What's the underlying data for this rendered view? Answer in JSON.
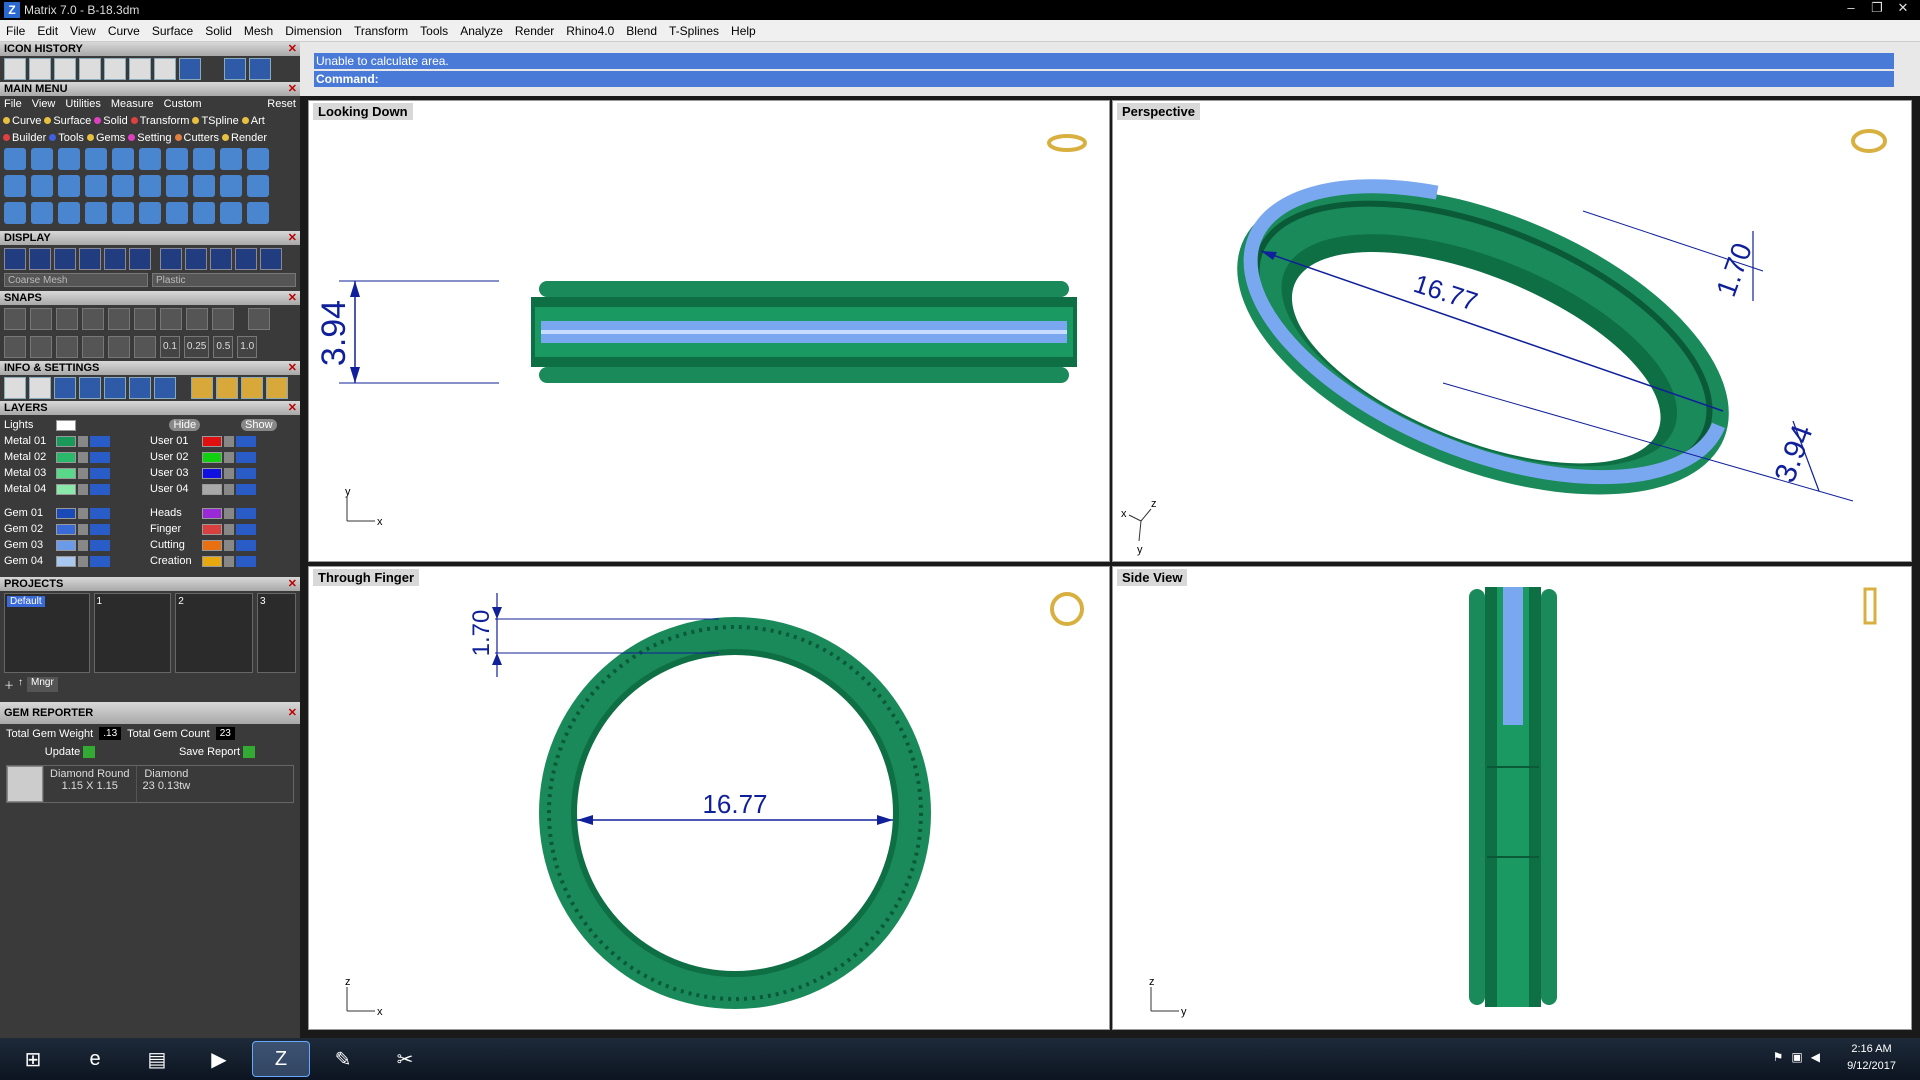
{
  "window": {
    "title": "Matrix 7.0 - B-18.3dm",
    "controls": [
      "–",
      "❐",
      "✕"
    ]
  },
  "menubar": [
    "File",
    "Edit",
    "View",
    "Curve",
    "Surface",
    "Solid",
    "Mesh",
    "Dimension",
    "Transform",
    "Tools",
    "Analyze",
    "Render",
    "Rhino4.0",
    "Blend",
    "T-Splines",
    "Help"
  ],
  "left": {
    "icon_history": "ICON HISTORY",
    "main_menu": {
      "title": "MAIN MENU",
      "tabs": [
        "File",
        "View",
        "Utilities",
        "Measure",
        "Custom"
      ],
      "reset": "Reset",
      "row1": [
        {
          "label": "Curve",
          "color": "#e8c040"
        },
        {
          "label": "Surface",
          "color": "#e8c040"
        },
        {
          "label": "Solid",
          "color": "#e040c0"
        },
        {
          "label": "Transform",
          "color": "#e04040"
        },
        {
          "label": "TSpline",
          "color": "#e8c040"
        },
        {
          "label": "Art",
          "color": "#e8c040"
        }
      ],
      "row2": [
        {
          "label": "Builder",
          "color": "#e04040"
        },
        {
          "label": "Tools",
          "color": "#4060e0"
        },
        {
          "label": "Gems",
          "color": "#e8c040"
        },
        {
          "label": "Setting",
          "color": "#e040c0"
        },
        {
          "label": "Cutters",
          "color": "#e08040"
        },
        {
          "label": "Render",
          "color": "#e8c040"
        }
      ]
    },
    "display": {
      "title": "DISPLAY",
      "mesh": "Coarse Mesh",
      "material": "Plastic"
    },
    "snaps": {
      "title": "SNAPS",
      "values": [
        "0.1",
        "0.25",
        "0.5",
        "1.0"
      ]
    },
    "info_settings": "INFO & SETTINGS",
    "layers": {
      "title": "LAYERS",
      "lights": "Lights",
      "hide": "Hide",
      "show": "Show",
      "left_col": [
        {
          "name": "Metal 01",
          "color": "#1a9a5a"
        },
        {
          "name": "Metal 02",
          "color": "#2ab86a"
        },
        {
          "name": "Metal 03",
          "color": "#5ad88a"
        },
        {
          "name": "Metal 04",
          "color": "#8ae8aa"
        },
        {
          "name": "Gem 01",
          "color": "#1a4ab8"
        },
        {
          "name": "Gem 02",
          "color": "#3a6ad8"
        },
        {
          "name": "Gem 03",
          "color": "#6a9ae8"
        },
        {
          "name": "Gem 04",
          "color": "#a8c8f0"
        }
      ],
      "right_col": [
        {
          "name": "User 01",
          "color": "#e01010"
        },
        {
          "name": "User 02",
          "color": "#10d010"
        },
        {
          "name": "User 03",
          "color": "#1010e0"
        },
        {
          "name": "User 04",
          "color": "#a8a8a8"
        },
        {
          "name": "Heads",
          "color": "#9a2ad8"
        },
        {
          "name": "Finger",
          "color": "#d84040"
        },
        {
          "name": "Cutting",
          "color": "#e87010"
        },
        {
          "name": "Creation",
          "color": "#e8a810"
        }
      ]
    },
    "projects": {
      "title": "PROJECTS",
      "default": "Default",
      "slots": [
        "1",
        "2",
        "3"
      ],
      "mngr": "Mngr"
    },
    "gem_reporter": {
      "title": "GEM REPORTER",
      "total_weight_label": "Total Gem Weight",
      "total_weight": ".13",
      "total_count_label": "Total Gem Count",
      "total_count": "23",
      "update": "Update",
      "save_report": "Save Report",
      "gem_name": "Diamond Round",
      "gem_size": "1.15 X 1.15",
      "gem_type": "Diamond",
      "gem_count": "23",
      "gem_tw": "0.13tw"
    }
  },
  "command": {
    "status": "Unable to calculate area.",
    "prompt": "Command:"
  },
  "viewports": {
    "top_left": {
      "label": "Looking Down",
      "dim": "3.94"
    },
    "top_right": {
      "label": "Perspective",
      "dims": [
        "16.77",
        "1.70",
        "3.94"
      ]
    },
    "bottom_left": {
      "label": "Through Finger",
      "dims": [
        "1.70",
        "16.77"
      ]
    },
    "bottom_right": {
      "label": "Side View"
    }
  },
  "colors": {
    "metal": "#1a8a5a",
    "metal_dark": "#0a5a38",
    "gem": "#7aa8f0",
    "dim": "#10209a"
  },
  "taskbar": {
    "time": "2:16 AM",
    "date": "9/12/2017"
  }
}
